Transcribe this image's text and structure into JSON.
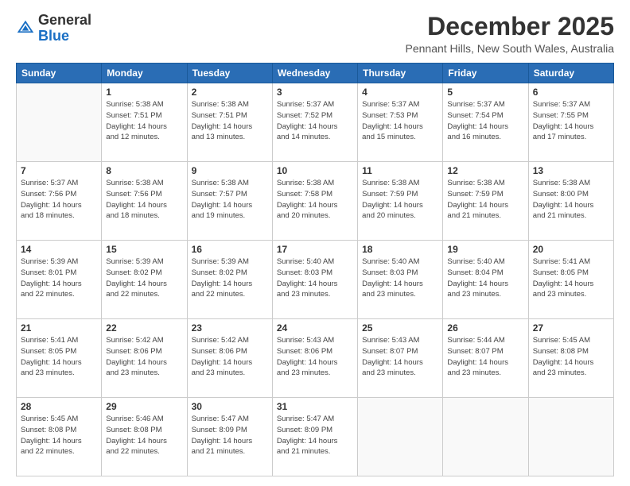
{
  "header": {
    "logo": {
      "line1": "General",
      "line2": "Blue"
    },
    "title": "December 2025",
    "location": "Pennant Hills, New South Wales, Australia"
  },
  "days_of_week": [
    "Sunday",
    "Monday",
    "Tuesday",
    "Wednesday",
    "Thursday",
    "Friday",
    "Saturday"
  ],
  "weeks": [
    [
      {
        "day": "",
        "info": ""
      },
      {
        "day": "1",
        "info": "Sunrise: 5:38 AM\nSunset: 7:51 PM\nDaylight: 14 hours\nand 12 minutes."
      },
      {
        "day": "2",
        "info": "Sunrise: 5:38 AM\nSunset: 7:51 PM\nDaylight: 14 hours\nand 13 minutes."
      },
      {
        "day": "3",
        "info": "Sunrise: 5:37 AM\nSunset: 7:52 PM\nDaylight: 14 hours\nand 14 minutes."
      },
      {
        "day": "4",
        "info": "Sunrise: 5:37 AM\nSunset: 7:53 PM\nDaylight: 14 hours\nand 15 minutes."
      },
      {
        "day": "5",
        "info": "Sunrise: 5:37 AM\nSunset: 7:54 PM\nDaylight: 14 hours\nand 16 minutes."
      },
      {
        "day": "6",
        "info": "Sunrise: 5:37 AM\nSunset: 7:55 PM\nDaylight: 14 hours\nand 17 minutes."
      }
    ],
    [
      {
        "day": "7",
        "info": "Sunrise: 5:37 AM\nSunset: 7:56 PM\nDaylight: 14 hours\nand 18 minutes."
      },
      {
        "day": "8",
        "info": "Sunrise: 5:38 AM\nSunset: 7:56 PM\nDaylight: 14 hours\nand 18 minutes."
      },
      {
        "day": "9",
        "info": "Sunrise: 5:38 AM\nSunset: 7:57 PM\nDaylight: 14 hours\nand 19 minutes."
      },
      {
        "day": "10",
        "info": "Sunrise: 5:38 AM\nSunset: 7:58 PM\nDaylight: 14 hours\nand 20 minutes."
      },
      {
        "day": "11",
        "info": "Sunrise: 5:38 AM\nSunset: 7:59 PM\nDaylight: 14 hours\nand 20 minutes."
      },
      {
        "day": "12",
        "info": "Sunrise: 5:38 AM\nSunset: 7:59 PM\nDaylight: 14 hours\nand 21 minutes."
      },
      {
        "day": "13",
        "info": "Sunrise: 5:38 AM\nSunset: 8:00 PM\nDaylight: 14 hours\nand 21 minutes."
      }
    ],
    [
      {
        "day": "14",
        "info": "Sunrise: 5:39 AM\nSunset: 8:01 PM\nDaylight: 14 hours\nand 22 minutes."
      },
      {
        "day": "15",
        "info": "Sunrise: 5:39 AM\nSunset: 8:02 PM\nDaylight: 14 hours\nand 22 minutes."
      },
      {
        "day": "16",
        "info": "Sunrise: 5:39 AM\nSunset: 8:02 PM\nDaylight: 14 hours\nand 22 minutes."
      },
      {
        "day": "17",
        "info": "Sunrise: 5:40 AM\nSunset: 8:03 PM\nDaylight: 14 hours\nand 23 minutes."
      },
      {
        "day": "18",
        "info": "Sunrise: 5:40 AM\nSunset: 8:03 PM\nDaylight: 14 hours\nand 23 minutes."
      },
      {
        "day": "19",
        "info": "Sunrise: 5:40 AM\nSunset: 8:04 PM\nDaylight: 14 hours\nand 23 minutes."
      },
      {
        "day": "20",
        "info": "Sunrise: 5:41 AM\nSunset: 8:05 PM\nDaylight: 14 hours\nand 23 minutes."
      }
    ],
    [
      {
        "day": "21",
        "info": "Sunrise: 5:41 AM\nSunset: 8:05 PM\nDaylight: 14 hours\nand 23 minutes."
      },
      {
        "day": "22",
        "info": "Sunrise: 5:42 AM\nSunset: 8:06 PM\nDaylight: 14 hours\nand 23 minutes."
      },
      {
        "day": "23",
        "info": "Sunrise: 5:42 AM\nSunset: 8:06 PM\nDaylight: 14 hours\nand 23 minutes."
      },
      {
        "day": "24",
        "info": "Sunrise: 5:43 AM\nSunset: 8:06 PM\nDaylight: 14 hours\nand 23 minutes."
      },
      {
        "day": "25",
        "info": "Sunrise: 5:43 AM\nSunset: 8:07 PM\nDaylight: 14 hours\nand 23 minutes."
      },
      {
        "day": "26",
        "info": "Sunrise: 5:44 AM\nSunset: 8:07 PM\nDaylight: 14 hours\nand 23 minutes."
      },
      {
        "day": "27",
        "info": "Sunrise: 5:45 AM\nSunset: 8:08 PM\nDaylight: 14 hours\nand 23 minutes."
      }
    ],
    [
      {
        "day": "28",
        "info": "Sunrise: 5:45 AM\nSunset: 8:08 PM\nDaylight: 14 hours\nand 22 minutes."
      },
      {
        "day": "29",
        "info": "Sunrise: 5:46 AM\nSunset: 8:08 PM\nDaylight: 14 hours\nand 22 minutes."
      },
      {
        "day": "30",
        "info": "Sunrise: 5:47 AM\nSunset: 8:09 PM\nDaylight: 14 hours\nand 21 minutes."
      },
      {
        "day": "31",
        "info": "Sunrise: 5:47 AM\nSunset: 8:09 PM\nDaylight: 14 hours\nand 21 minutes."
      },
      {
        "day": "",
        "info": ""
      },
      {
        "day": "",
        "info": ""
      },
      {
        "day": "",
        "info": ""
      }
    ]
  ]
}
